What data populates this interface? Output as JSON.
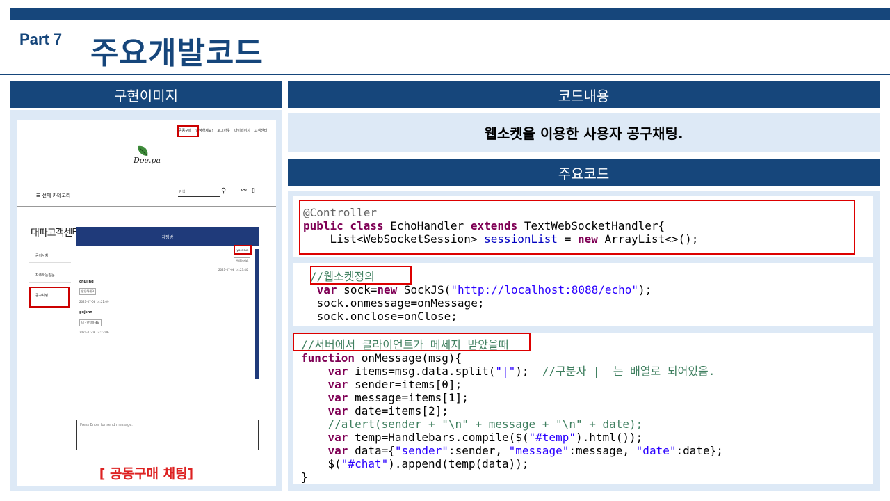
{
  "header": {
    "part": "Part 7",
    "title": "주요개발코드"
  },
  "left_panel": {
    "title": "구현이미지",
    "caption": "[ 공동구매 채팅]"
  },
  "screenshot": {
    "nav_links": [
      "공동구매",
      "안녕하세요!",
      "로그아웃",
      "마이페이지",
      "고객센터"
    ],
    "logo_text": "Doe.pa",
    "category_menu": "☰ 전체 카테고리",
    "search_placeholder": "검색",
    "cs_title": "대파고객센터",
    "side_items": [
      "공지사항",
      "자주하는질문",
      "공구채팅"
    ],
    "chat_header": "채팅방",
    "chat_me": "yoonsun",
    "chat_me_msg": "안녕하세요",
    "chat_me_time": "2021-07-08 14:23:40",
    "chat1_user": "chuling",
    "chat1_msg": "안녕하세요",
    "chat1_time": "2021-07-08 14:21:09",
    "chat2_user": "gojsnn",
    "chat2_msg": "네 - 안녕하세요",
    "chat2_time": "2021-07-08 14:22:06",
    "input_placeholder": "Press Enter for send message."
  },
  "right_panel": {
    "title": "코드내용",
    "description": "웹소켓을 이용한 사용자 공구채팅.",
    "code_title": "주요코드"
  },
  "code_blocks": {
    "block1": {
      "line1": "@Controller",
      "line2_kw1": "public class",
      "line2_rest": " EchoHandler ",
      "line2_kw2": "extends",
      "line2_end": " TextWebSocketHandler{",
      "line3_start": "    List<WebSocketSession> ",
      "line3_field": "sessionList",
      "line3_mid": " = ",
      "line3_kw": "new",
      "line3_end": " ArrayList<>();"
    },
    "block2": {
      "comment": "//웹소켓정의",
      "line1_kw": "var",
      "line1_a": " sock=",
      "line1_kw2": "new",
      "line1_b": " SockJS(",
      "line1_str": "\"http://localhost:8088/echo\"",
      "line1_end": ");",
      "line2": " sock.onmessage=onMessage;",
      "line3": " sock.onclose=onClose;"
    },
    "block3": {
      "comment": "//서버에서 클라이언트가 메세지 받았을때",
      "l1_kw": "function",
      "l1_rest": " onMessage(msg){",
      "l2_kw": "var",
      "l2_a": " items=msg.data.split(",
      "l2_str": "\"|\"",
      "l2_b": ");  ",
      "l2_cmt": "//구분자 |  는 배열로 되어있음.",
      "l3_kw": "var",
      "l3_rest": " sender=items[0];",
      "l4_kw": "var",
      "l4_rest": " message=items[1];",
      "l5_kw": "var",
      "l5_rest": " date=items[2];",
      "l6_cmt": "//alert(sender + \"\\n\" + message + \"\\n\" + date);",
      "l7_kw": "var",
      "l7_a": " temp=Handlebars.compile($(",
      "l7_str": "\"#temp\"",
      "l7_end": ").html());",
      "l8_kw": "var",
      "l8_a": " data={",
      "l8_s1": "\"sender\"",
      "l8_b": ":sender, ",
      "l8_s2": "\"message\"",
      "l8_c": ":message, ",
      "l8_s3": "\"date\"",
      "l8_end": ":date};",
      "l9_a": "$(",
      "l9_str": "\"#chat\"",
      "l9_end": ").append(temp(data));",
      "l10": "}"
    }
  }
}
